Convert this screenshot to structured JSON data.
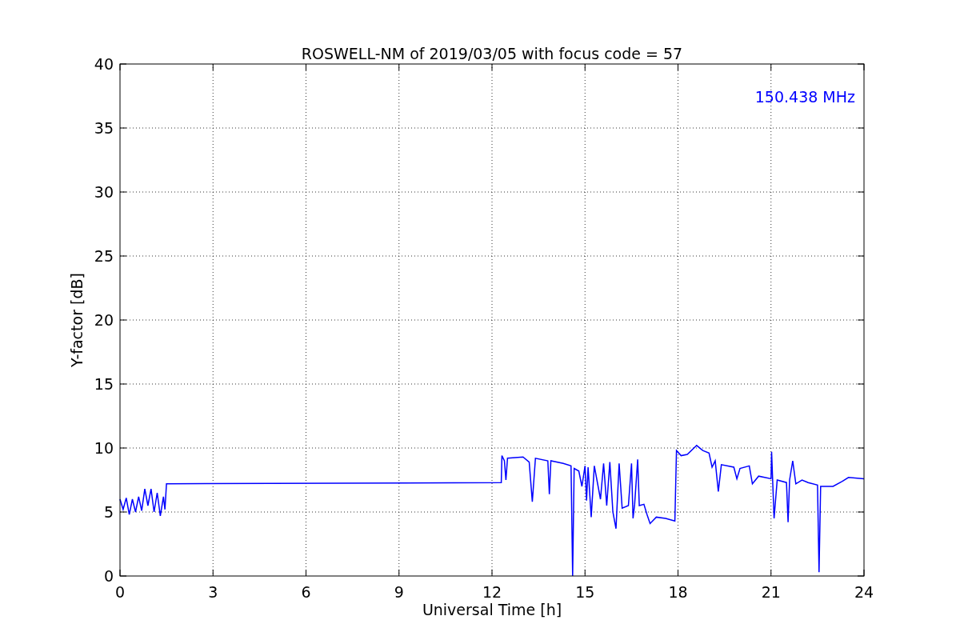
{
  "chart_data": {
    "type": "line",
    "title": "ROSWELL-NM of 2019/03/05 with focus code = 57",
    "xlabel": "Universal Time [h]",
    "ylabel": "Y-factor [dB]",
    "x": [
      0,
      0.1,
      0.2,
      0.3,
      0.4,
      0.5,
      0.6,
      0.7,
      0.8,
      0.9,
      1.0,
      1.1,
      1.2,
      1.3,
      1.4,
      1.45,
      1.5,
      12.3,
      12.32,
      12.4,
      12.45,
      12.5,
      13.0,
      13.2,
      13.3,
      13.4,
      13.8,
      13.85,
      13.9,
      14.3,
      14.55,
      14.6,
      14.65,
      14.8,
      14.9,
      15.0,
      15.05,
      15.1,
      15.2,
      15.3,
      15.5,
      15.6,
      15.7,
      15.8,
      15.9,
      16.0,
      16.1,
      16.2,
      16.4,
      16.5,
      16.55,
      16.6,
      16.7,
      16.75,
      16.9,
      17.0,
      17.1,
      17.3,
      17.6,
      17.9,
      17.95,
      18.1,
      18.3,
      18.6,
      18.8,
      19.0,
      19.1,
      19.2,
      19.3,
      19.4,
      19.8,
      19.9,
      20.0,
      20.3,
      20.4,
      20.6,
      21.0,
      21.02,
      21.1,
      21.2,
      21.5,
      21.55,
      21.6,
      21.7,
      21.8,
      22.0,
      22.2,
      22.5,
      22.55,
      22.6,
      23.0,
      23.3,
      23.5,
      24.0
    ],
    "series": [
      {
        "name": "150.438 MHz",
        "color": "#0000ff",
        "values": [
          6.0,
          5.2,
          6.1,
          4.8,
          6.0,
          5.0,
          6.2,
          5.1,
          6.8,
          5.5,
          6.8,
          5.0,
          6.5,
          4.7,
          6.2,
          5.2,
          7.2,
          7.3,
          9.4,
          9.0,
          7.5,
          9.2,
          9.3,
          8.9,
          5.8,
          9.2,
          9.0,
          6.4,
          9.0,
          8.8,
          8.6,
          0.0,
          8.4,
          8.2,
          7.0,
          8.6,
          5.9,
          8.5,
          4.6,
          8.6,
          6.0,
          8.8,
          5.5,
          8.9,
          5.0,
          3.7,
          8.8,
          5.3,
          5.5,
          8.8,
          4.5,
          5.6,
          9.1,
          5.5,
          5.6,
          4.8,
          4.1,
          4.6,
          4.5,
          4.3,
          9.8,
          9.4,
          9.5,
          10.2,
          9.8,
          9.6,
          8.5,
          9.0,
          6.6,
          8.7,
          8.5,
          7.6,
          8.4,
          8.6,
          7.2,
          7.8,
          7.6,
          9.7,
          4.5,
          7.5,
          7.3,
          4.2,
          7.5,
          9.0,
          7.2,
          7.5,
          7.3,
          7.1,
          0.3,
          7.0,
          7.0,
          7.4,
          7.7,
          7.6
        ]
      }
    ],
    "xlim": [
      0,
      24
    ],
    "ylim": [
      0,
      40
    ],
    "xticks": [
      0,
      3,
      6,
      9,
      12,
      15,
      18,
      21,
      24
    ],
    "yticks": [
      0,
      5,
      10,
      15,
      20,
      25,
      30,
      35,
      40
    ],
    "grid": true
  }
}
